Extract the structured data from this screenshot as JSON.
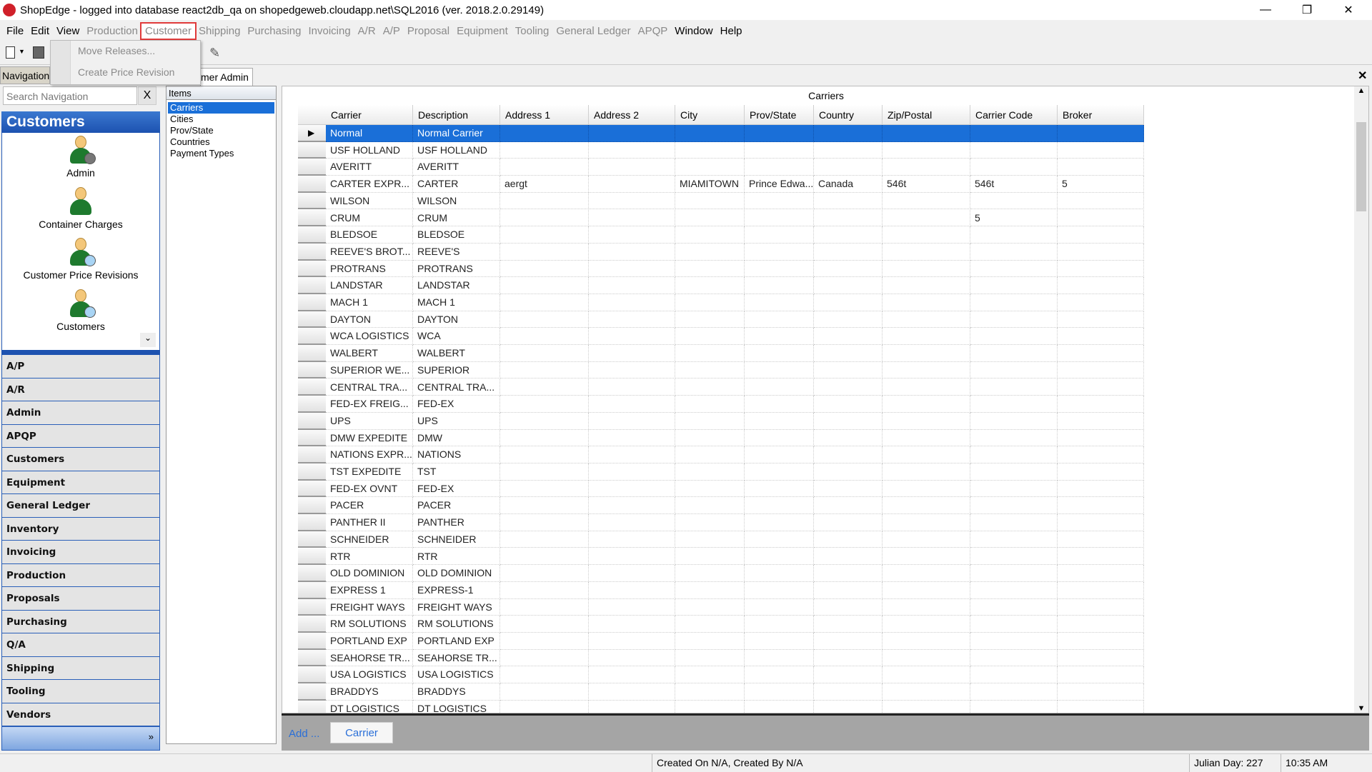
{
  "window": {
    "title": "ShopEdge -  logged into database react2db_qa on shopedgeweb.cloudapp.net\\SQL2016 (ver. 2018.2.0.29149)",
    "controls": [
      "minimize",
      "restore",
      "close"
    ]
  },
  "menu": [
    {
      "label": "File",
      "enabled": true
    },
    {
      "label": "Edit",
      "enabled": true
    },
    {
      "label": "View",
      "enabled": true
    },
    {
      "label": "Production",
      "enabled": false
    },
    {
      "label": "Customer",
      "enabled": false,
      "active": true
    },
    {
      "label": "Shipping",
      "enabled": false
    },
    {
      "label": "Purchasing",
      "enabled": false
    },
    {
      "label": "Invoicing",
      "enabled": false
    },
    {
      "label": "A/R",
      "enabled": false
    },
    {
      "label": "A/P",
      "enabled": false
    },
    {
      "label": "Proposal",
      "enabled": false
    },
    {
      "label": "Equipment",
      "enabled": false
    },
    {
      "label": "Tooling",
      "enabled": false
    },
    {
      "label": "General Ledger",
      "enabled": false
    },
    {
      "label": "APQP",
      "enabled": false
    },
    {
      "label": "Window",
      "enabled": true
    },
    {
      "label": "Help",
      "enabled": true
    }
  ],
  "dropdown": {
    "items": [
      "Move Releases...",
      "Create Price Revision"
    ]
  },
  "tabs": {
    "navigation": "Navigation",
    "document": "mer Admin"
  },
  "nav": {
    "search_placeholder": "Search Navigation",
    "clear": "X",
    "header": "Customers",
    "icons": [
      {
        "label": "Admin",
        "icon": "admin-gear"
      },
      {
        "label": "Container Charges",
        "icon": "person"
      },
      {
        "label": "Customer Price Revisions",
        "icon": "person-search"
      },
      {
        "label": "Customers",
        "icon": "person-search"
      }
    ],
    "groups": [
      "A/P",
      "A/R",
      "Admin",
      "APQP",
      "Customers",
      "Equipment",
      "General Ledger",
      "Inventory",
      "Invoicing",
      "Production",
      "Proposals",
      "Purchasing",
      "Q/A",
      "Shipping",
      "Tooling",
      "Vendors"
    ],
    "more": "»"
  },
  "items": {
    "header": "Items",
    "list": [
      "Carriers",
      "Cities",
      "Prov/State",
      "Countries",
      "Payment Types"
    ],
    "selected": 0
  },
  "grid": {
    "title": "Carriers",
    "columns": [
      "Carrier",
      "Description",
      "Address 1",
      "Address 2",
      "City",
      "Prov/State",
      "Country",
      "Zip/Postal",
      "Carrier Code",
      "Broker"
    ],
    "selected_row": 0,
    "rows": [
      [
        "Normal",
        "Normal Carrier",
        "",
        "",
        "",
        "",
        "",
        "",
        "",
        ""
      ],
      [
        "USF HOLLAND",
        "USF HOLLAND",
        "",
        "",
        "",
        "",
        "",
        "",
        "",
        ""
      ],
      [
        "AVERITT",
        "AVERITT",
        "",
        "",
        "",
        "",
        "",
        "",
        "",
        ""
      ],
      [
        "CARTER  EXPR...",
        "CARTER",
        "aergt",
        "",
        "MIAMITOWN",
        "Prince Edwa...",
        "Canada",
        "546t",
        "546t",
        "5"
      ],
      [
        "WILSON",
        "WILSON",
        "",
        "",
        "",
        "",
        "",
        "",
        "",
        ""
      ],
      [
        "CRUM",
        "CRUM",
        "",
        "",
        "",
        "",
        "",
        "",
        "5",
        ""
      ],
      [
        "BLEDSOE",
        "BLEDSOE",
        "",
        "",
        "",
        "",
        "",
        "",
        "",
        ""
      ],
      [
        "REEVE'S  BROT...",
        "REEVE'S",
        "",
        "",
        "",
        "",
        "",
        "",
        "",
        ""
      ],
      [
        "PROTRANS",
        "PROTRANS",
        "",
        "",
        "",
        "",
        "",
        "",
        "",
        ""
      ],
      [
        "LANDSTAR",
        "LANDSTAR",
        "",
        "",
        "",
        "",
        "",
        "",
        "",
        ""
      ],
      [
        "MACH 1",
        "MACH 1",
        "",
        "",
        "",
        "",
        "",
        "",
        "",
        ""
      ],
      [
        "DAYTON",
        "DAYTON",
        "",
        "",
        "",
        "",
        "",
        "",
        "",
        ""
      ],
      [
        "WCA LOGISTICS",
        "WCA",
        "",
        "",
        "",
        "",
        "",
        "",
        "",
        ""
      ],
      [
        "WALBERT",
        "WALBERT",
        "",
        "",
        "",
        "",
        "",
        "",
        "",
        ""
      ],
      [
        "SUPERIOR  WE...",
        "SUPERIOR",
        "",
        "",
        "",
        "",
        "",
        "",
        "",
        ""
      ],
      [
        "CENTRAL  TRA...",
        "CENTRAL  TRA...",
        "",
        "",
        "",
        "",
        "",
        "",
        "",
        ""
      ],
      [
        "FED-EX  FREIG...",
        "FED-EX",
        "",
        "",
        "",
        "",
        "",
        "",
        "",
        ""
      ],
      [
        "UPS",
        "UPS",
        "",
        "",
        "",
        "",
        "",
        "",
        "",
        ""
      ],
      [
        "DMW EXPEDITE",
        "DMW",
        "",
        "",
        "",
        "",
        "",
        "",
        "",
        ""
      ],
      [
        "NATIONS  EXPR...",
        "NATIONS",
        "",
        "",
        "",
        "",
        "",
        "",
        "",
        ""
      ],
      [
        "TST EXPEDITE",
        "TST",
        "",
        "",
        "",
        "",
        "",
        "",
        "",
        ""
      ],
      [
        "FED-EX OVNT",
        "FED-EX",
        "",
        "",
        "",
        "",
        "",
        "",
        "",
        ""
      ],
      [
        "PACER",
        "PACER",
        "",
        "",
        "",
        "",
        "",
        "",
        "",
        ""
      ],
      [
        "PANTHER II",
        "PANTHER",
        "",
        "",
        "",
        "",
        "",
        "",
        "",
        ""
      ],
      [
        "SCHNEIDER",
        "SCHNEIDER",
        "",
        "",
        "",
        "",
        "",
        "",
        "",
        ""
      ],
      [
        "RTR",
        "RTR",
        "",
        "",
        "",
        "",
        "",
        "",
        "",
        ""
      ],
      [
        "OLD DOMINION",
        "OLD DOMINION",
        "",
        "",
        "",
        "",
        "",
        "",
        "",
        ""
      ],
      [
        "EXPRESS 1",
        "EXPRESS-1",
        "",
        "",
        "",
        "",
        "",
        "",
        "",
        ""
      ],
      [
        "FREIGHT WAYS",
        "FREIGHT WAYS",
        "",
        "",
        "",
        "",
        "",
        "",
        "",
        ""
      ],
      [
        "RM SOLUTIONS",
        "RM SOLUTIONS",
        "",
        "",
        "",
        "",
        "",
        "",
        "",
        ""
      ],
      [
        "PORTLAND EXP",
        "PORTLAND EXP",
        "",
        "",
        "",
        "",
        "",
        "",
        "",
        ""
      ],
      [
        "SEAHORSE  TR...",
        "SEAHORSE  TR...",
        "",
        "",
        "",
        "",
        "",
        "",
        "",
        ""
      ],
      [
        "USA LOGISTICS",
        "USA LOGISTICS",
        "",
        "",
        "",
        "",
        "",
        "",
        "",
        ""
      ],
      [
        "BRADDYS",
        "BRADDYS",
        "",
        "",
        "",
        "",
        "",
        "",
        "",
        ""
      ],
      [
        "DT LOGISTICS",
        "DT LOGISTICS",
        "",
        "",
        "",
        "",
        "",
        "",
        "",
        ""
      ]
    ]
  },
  "add_panel": {
    "add_label": "Add ...",
    "button": "Carrier"
  },
  "status": {
    "created": "Created On N/A, Created By N/A",
    "julian": "Julian Day: 227",
    "time": "10:35 AM"
  },
  "colors": {
    "selection": "#1a6fd8",
    "nav_header": "#1d52b0",
    "highlight_outline": "#e03a3a"
  }
}
